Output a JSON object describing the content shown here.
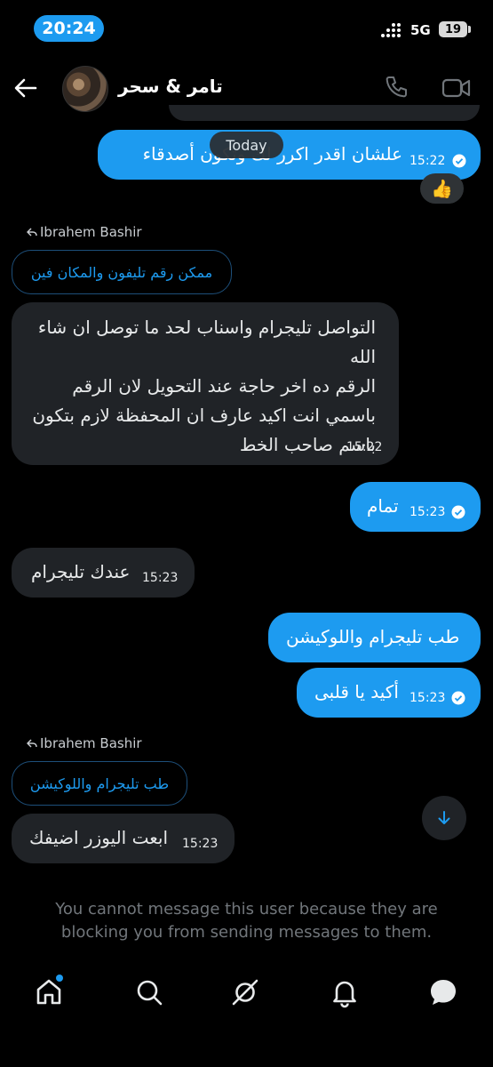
{
  "status_bar": {
    "time": "20:24",
    "network": "5G",
    "battery": "19"
  },
  "header": {
    "title": "تامر & سحر"
  },
  "date_separator": "Today",
  "messages": [
    {
      "dir": "out",
      "text": "علشان اقدر اكرر لك وتكون أصدقاء",
      "time": "15:22"
    },
    {
      "dir": "in_reply",
      "reply_to": "Ibrahem Bashir",
      "quote": "ممكن رقم تليفون والمكان فين",
      "lines": [
        "التواصل تليجرام واسناب لحد ما توصل ان شاء",
        "الله",
        "الرقم ده اخر حاجة عند التحويل لان الرقم",
        "باسمي انت اكيد عارف ان المحفظة لازم بتكون",
        "باسم صاحب الخط"
      ],
      "time": "15:22"
    },
    {
      "dir": "out",
      "text": "تمام",
      "time": "15:23"
    },
    {
      "dir": "in",
      "text": "عندك تليجرام",
      "time": "15:23"
    },
    {
      "dir": "out",
      "text": "طب تليجرام واللوكيشن"
    },
    {
      "dir": "out",
      "text": "أكيد يا قلبى",
      "time": "15:23"
    },
    {
      "dir": "in_reply",
      "reply_to": "Ibrahem Bashir",
      "quote": "طب تليجرام واللوكيشن",
      "text": "ابعت اليوزر اضيفك",
      "time": "15:23"
    }
  ],
  "reaction": "👍",
  "blocked_notice": "You cannot message this user because they are blocking you from sending messages to them.",
  "nav": [
    "home-icon",
    "search-icon",
    "grok-icon",
    "notifications-icon",
    "messages-icon"
  ],
  "colors": {
    "accent": "#1d9bf0",
    "incoming": "#202327",
    "background": "#000000"
  }
}
